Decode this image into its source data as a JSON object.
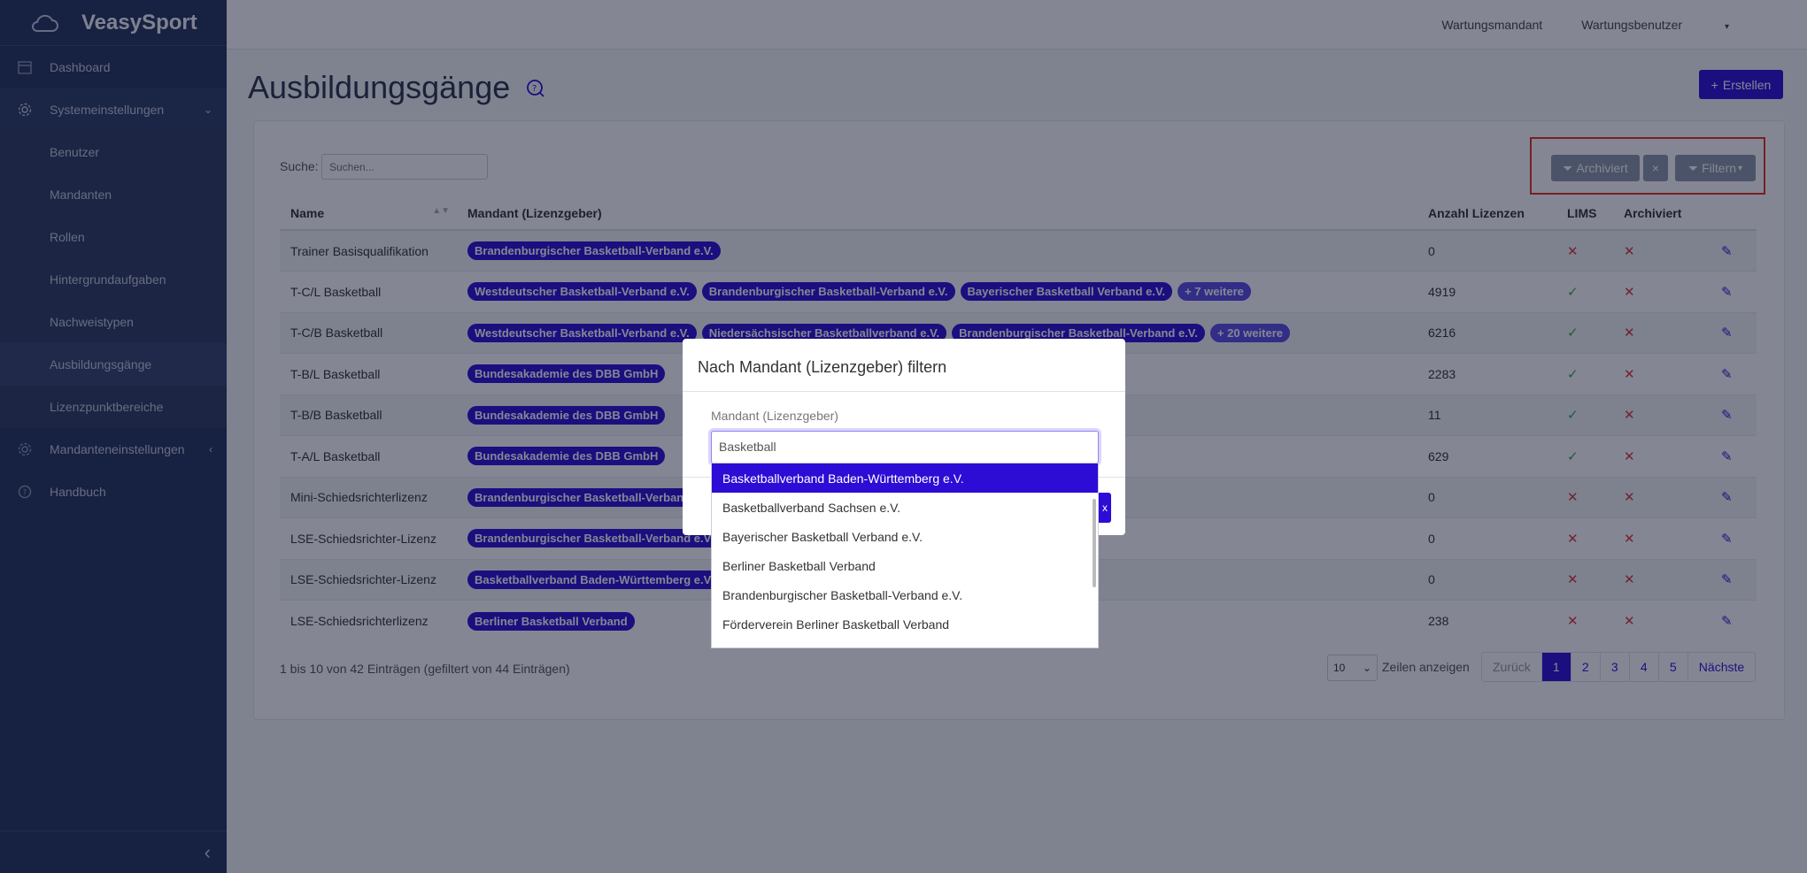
{
  "app": {
    "brand": "VeasySport"
  },
  "sidebar": {
    "items": [
      {
        "label": "Dashboard",
        "icon": "calendar-icon"
      },
      {
        "label": "Systemeinstellungen",
        "icon": "gear-icon"
      },
      {
        "label": "Benutzer"
      },
      {
        "label": "Mandanten"
      },
      {
        "label": "Rollen"
      },
      {
        "label": "Hintergrundaufgaben"
      },
      {
        "label": "Nachweistypen"
      },
      {
        "label": "Ausbildungsgänge"
      },
      {
        "label": "Lizenzpunktbereiche"
      },
      {
        "label": "Mandanteneinstellungen",
        "icon": "gear-icon"
      },
      {
        "label": "Handbuch",
        "icon": "help-chat-icon"
      }
    ]
  },
  "topbar": {
    "tenant": "Wartungsmandant",
    "user": "Wartungsbenutzer"
  },
  "page": {
    "title": "Ausbildungsgänge",
    "create_label": "Erstellen"
  },
  "search": {
    "label": "Suche:",
    "placeholder": "Suchen..."
  },
  "filters": {
    "archived_label": "Archiviert",
    "clear": "×",
    "filter_label": "Filtern"
  },
  "table": {
    "headers": [
      "Name",
      "Mandant (Lizenzgeber)",
      "Anzahl Lizenzen",
      "LIMS",
      "Archiviert"
    ],
    "rows": [
      {
        "name": "Trainer Basisqualifikation",
        "tags": [
          "Brandenburgischer Basketball-Verband e.V."
        ],
        "count": "0",
        "lims": false,
        "archived": false
      },
      {
        "name": "T-C/L Basketball",
        "tags": [
          "Westdeutscher Basketball-Verband e.V.",
          "Brandenburgischer Basketball-Verband e.V.",
          "Bayerischer Basketball Verband e.V.",
          "+ 7 weitere"
        ],
        "count": "4919",
        "lims": true,
        "archived": false
      },
      {
        "name": "T-C/B Basketball",
        "tags": [
          "Westdeutscher Basketball-Verband e.V.",
          "Niedersächsischer Basketballverband e.V.",
          "Brandenburgischer Basketball-Verband e.V.",
          "+ 20 weitere"
        ],
        "count": "6216",
        "lims": true,
        "archived": false
      },
      {
        "name": "T-B/L Basketball",
        "tags": [
          "Bundesakademie des DBB GmbH"
        ],
        "count": "2283",
        "lims": true,
        "archived": false
      },
      {
        "name": "T-B/B Basketball",
        "tags": [
          "Bundesakademie des DBB GmbH"
        ],
        "count": "11",
        "lims": true,
        "archived": false
      },
      {
        "name": "T-A/L Basketball",
        "tags": [
          "Bundesakademie des DBB GmbH"
        ],
        "count": "629",
        "lims": true,
        "archived": false
      },
      {
        "name": "Mini-Schiedsrichterlizenz",
        "tags": [
          "Brandenburgischer Basketball-Verband e.V."
        ],
        "count": "0",
        "lims": false,
        "archived": false
      },
      {
        "name": "LSE-Schiedsrichter-Lizenz",
        "tags": [
          "Brandenburgischer Basketball-Verband e.V."
        ],
        "count": "0",
        "lims": false,
        "archived": false
      },
      {
        "name": "LSE-Schiedsrichter-Lizenz",
        "tags": [
          "Basketballverband Baden-Württemberg e.V."
        ],
        "count": "0",
        "lims": false,
        "archived": false
      },
      {
        "name": "LSE-Schiedsrichterlizenz",
        "tags": [
          "Berliner Basketball Verband"
        ],
        "count": "238",
        "lims": false,
        "archived": false
      }
    ]
  },
  "footer": {
    "info": "1 bis 10 von 42 Einträgen (gefiltert von 44 Einträgen)",
    "page_size": "10",
    "page_size_label": "Zeilen anzeigen",
    "prev": "Zurück",
    "pages": [
      "1",
      "2",
      "3",
      "4",
      "5"
    ],
    "next": "Nächste"
  },
  "modal": {
    "title": "Nach Mandant (Lizenzgeber) filtern",
    "field_label": "Mandant (Lizenzgeber)",
    "input_value": "Basketball",
    "options": [
      "Basketballverband Baden-Württemberg e.V.",
      "Basketballverband Sachsen e.V.",
      "Bayerischer Basketball Verband e.V.",
      "Berliner Basketball Verband",
      "Brandenburgischer Basketball-Verband e.V.",
      "Förderverein Berliner Basketball Verband"
    ]
  },
  "colors": {
    "primary": "#2d0cd6",
    "sidebar": "#25325a",
    "highlight_box": "#e4301e"
  }
}
